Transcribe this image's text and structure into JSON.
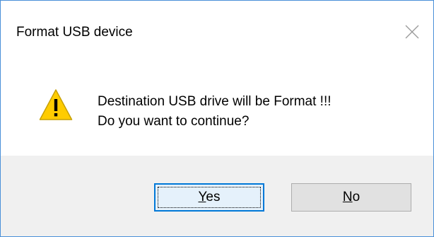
{
  "dialog": {
    "title": "Format USB device",
    "close_icon": "close-icon",
    "icon": "warning-icon",
    "message_line1": "Destination USB drive will be Format !!!",
    "message_line2": "Do you want to continue?",
    "buttons": {
      "yes_mnemonic": "Y",
      "yes_rest": "es",
      "no_mnemonic": "N",
      "no_rest": "o"
    },
    "colors": {
      "border": "#4a90d9",
      "footer_bg": "#f0f0f0",
      "default_button_border": "#0078d7",
      "default_button_bg": "#e5f1fb",
      "warning_fill": "#ffcc00"
    }
  }
}
